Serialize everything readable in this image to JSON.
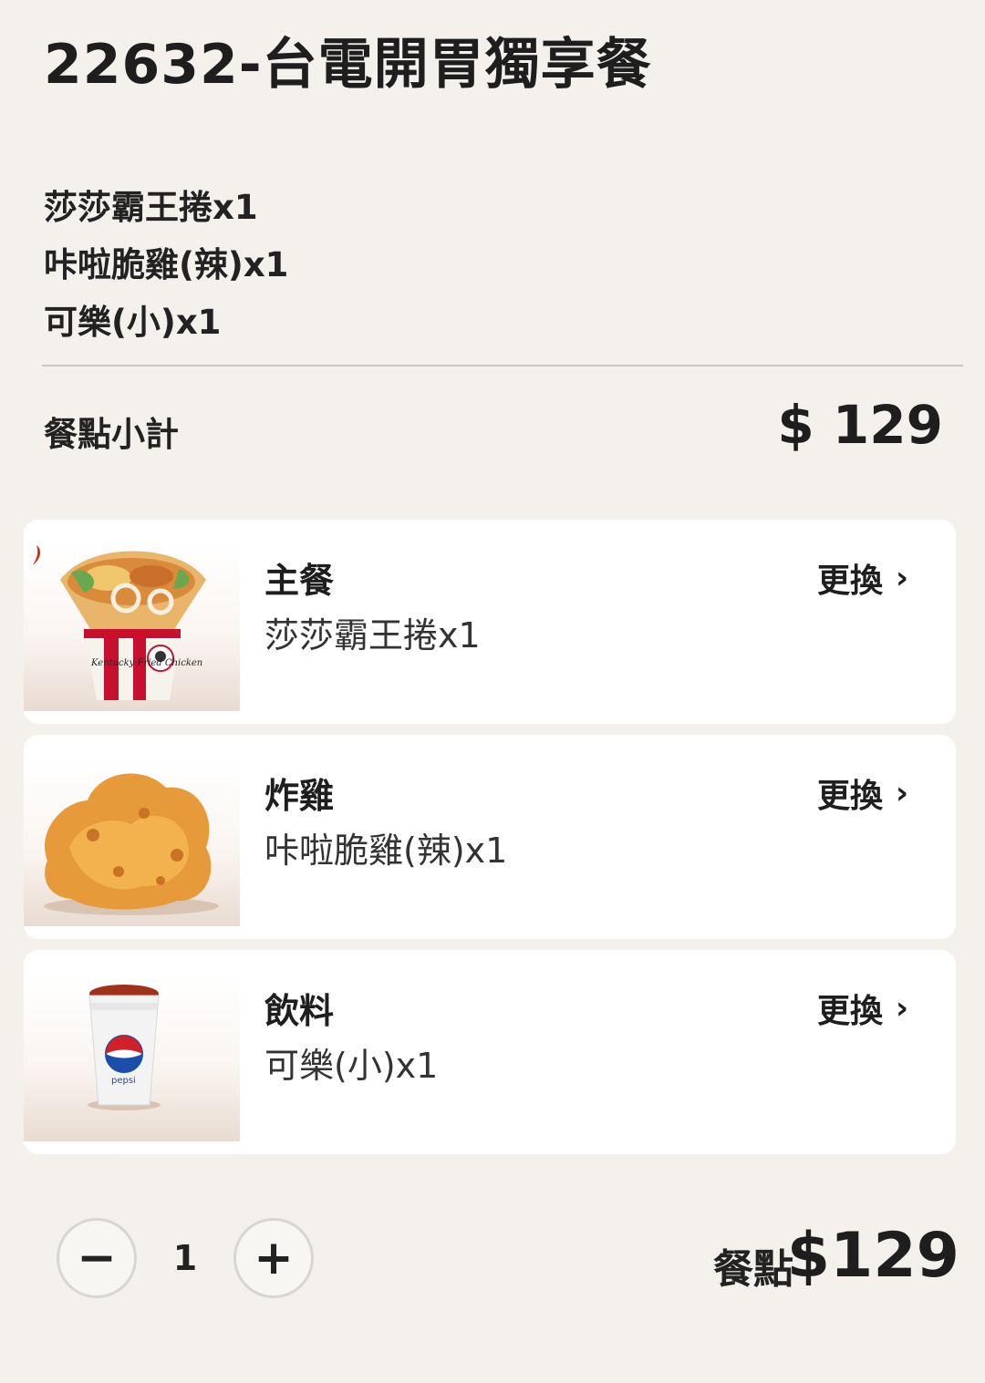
{
  "title": "22632-台電開胃獨享餐",
  "contents": [
    "莎莎霸王捲x1",
    "咔啦脆雞(辣)x1",
    "可樂(小)x1"
  ],
  "subtotal": {
    "label": "餐點小計",
    "value": "$ 129"
  },
  "cards": [
    {
      "category": "主餐",
      "item": "莎莎霸王捲x1",
      "change_label": "更換",
      "image": "wrap-image"
    },
    {
      "category": "炸雞",
      "item": "咔啦脆雞(辣)x1",
      "change_label": "更換",
      "image": "fried-chicken-image"
    },
    {
      "category": "飲料",
      "item": "可樂(小)x1",
      "change_label": "更換",
      "image": "cola-cup-image"
    }
  ],
  "quantity": {
    "minus_icon": "minus-icon",
    "value": "1",
    "plus_icon": "plus-icon"
  },
  "total": {
    "label": "餐點",
    "value": "$129"
  },
  "wrap_box_text": "Kentucky Fried Chicken",
  "cup_text": "pepsi",
  "colors": {
    "background": "#f4f1ed",
    "card": "#ffffff",
    "text": "#222222",
    "divider": "#cbc7c2"
  }
}
